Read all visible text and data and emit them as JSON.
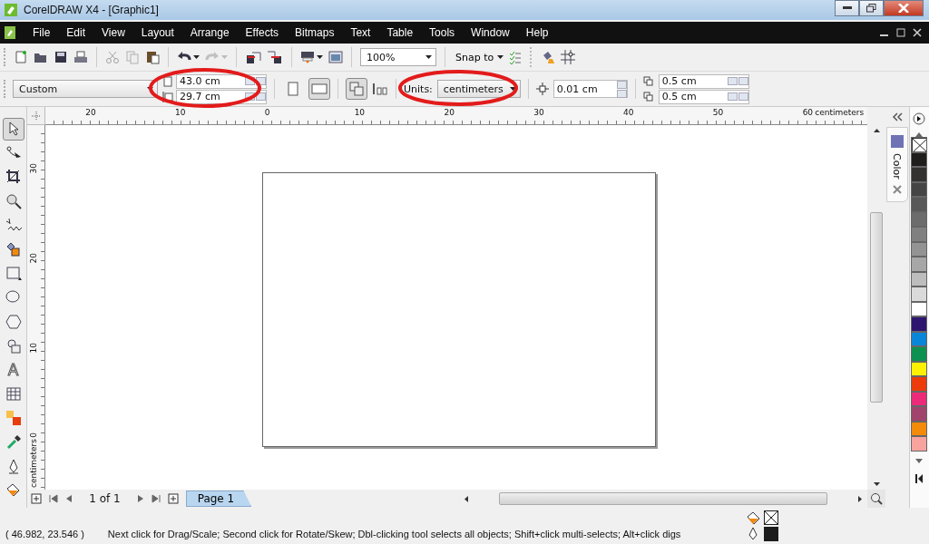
{
  "window": {
    "title": "CorelDRAW X4 - [Graphic1]"
  },
  "menu": [
    {
      "label": "File"
    },
    {
      "label": "Edit"
    },
    {
      "label": "View"
    },
    {
      "label": "Layout"
    },
    {
      "label": "Arrange"
    },
    {
      "label": "Effects"
    },
    {
      "label": "Bitmaps"
    },
    {
      "label": "Text"
    },
    {
      "label": "Table"
    },
    {
      "label": "Tools"
    },
    {
      "label": "Window"
    },
    {
      "label": "Help"
    }
  ],
  "toolbar": {
    "zoom": "100%",
    "snap": "Snap to"
  },
  "property_bar": {
    "paper": "Custom",
    "width": "43.0 cm",
    "height": "29.7 cm",
    "orientation": [
      {
        "kind": "portrait",
        "selected": false
      },
      {
        "kind": "landscape",
        "selected": true
      }
    ],
    "units_label": "Units:",
    "units": "centimeters",
    "nudge": "0.01 cm",
    "dup_x": "0.5 cm",
    "dup_y": "0.5 cm"
  },
  "rulers": {
    "horizontal": [
      "20",
      "10",
      "0",
      "10",
      "20",
      "30",
      "40",
      "50",
      "60"
    ],
    "horizontal_unit": "centimeters",
    "vertical": [
      "30",
      "20",
      "10",
      "0"
    ],
    "vertical_unit": "centimeters"
  },
  "toolbox": [
    {
      "kind": "pick",
      "selected": true
    },
    {
      "kind": "shape",
      "selected": false
    },
    {
      "kind": "crop",
      "selected": false
    },
    {
      "kind": "zoom",
      "selected": false
    },
    {
      "kind": "freehand",
      "selected": false
    },
    {
      "kind": "smartfill",
      "selected": false
    },
    {
      "kind": "rectangle",
      "selected": false
    },
    {
      "kind": "ellipse",
      "selected": false
    },
    {
      "kind": "polygon",
      "selected": false
    },
    {
      "kind": "shapes",
      "selected": false
    },
    {
      "kind": "text",
      "glyph": "A",
      "selected": false
    },
    {
      "kind": "table",
      "selected": false
    },
    {
      "kind": "blend",
      "selected": false
    },
    {
      "kind": "eyedropper",
      "selected": false
    },
    {
      "kind": "outline",
      "selected": false
    },
    {
      "kind": "fill",
      "selected": false
    }
  ],
  "docker": {
    "tab": "Color"
  },
  "palette": [
    {
      "kind": "none"
    },
    {
      "kind": "swatch",
      "color": "#201e1c"
    },
    {
      "kind": "swatch",
      "color": "#333231"
    },
    {
      "kind": "swatch",
      "color": "#464545"
    },
    {
      "kind": "swatch",
      "color": "#595858"
    },
    {
      "kind": "swatch",
      "color": "#6c6c6c"
    },
    {
      "kind": "swatch",
      "color": "#808080"
    },
    {
      "kind": "swatch",
      "color": "#939393"
    },
    {
      "kind": "swatch",
      "color": "#a7a7a7"
    },
    {
      "kind": "swatch",
      "color": "#bdbdbd"
    },
    {
      "kind": "swatch",
      "color": "#dadada"
    },
    {
      "kind": "swatch",
      "color": "#ffffff"
    },
    {
      "kind": "swatch",
      "color": "#2e1670"
    },
    {
      "kind": "swatch",
      "color": "#0a86d8"
    },
    {
      "kind": "swatch",
      "color": "#0c9150"
    },
    {
      "kind": "swatch",
      "color": "#fff200"
    },
    {
      "kind": "swatch",
      "color": "#ec3c0c"
    },
    {
      "kind": "swatch",
      "color": "#ec2a7a"
    },
    {
      "kind": "swatch",
      "color": "#a0446e"
    },
    {
      "kind": "swatch",
      "color": "#f38a0a"
    },
    {
      "kind": "swatch",
      "color": "#f8a39e"
    }
  ],
  "page_nav": {
    "count": "1 of 1",
    "tabs": [
      {
        "label": "Page 1",
        "selected": true
      }
    ]
  },
  "status": {
    "coords": "( 46.982, 23.546 )",
    "message": "Next click for Drag/Scale; Second click for Rotate/Skew; Dbl-clicking tool selects all objects; Shift+click multi-selects; Alt+click digs",
    "fill": {
      "kind": "none"
    },
    "outline": {
      "color": "#1c1c1c"
    }
  }
}
